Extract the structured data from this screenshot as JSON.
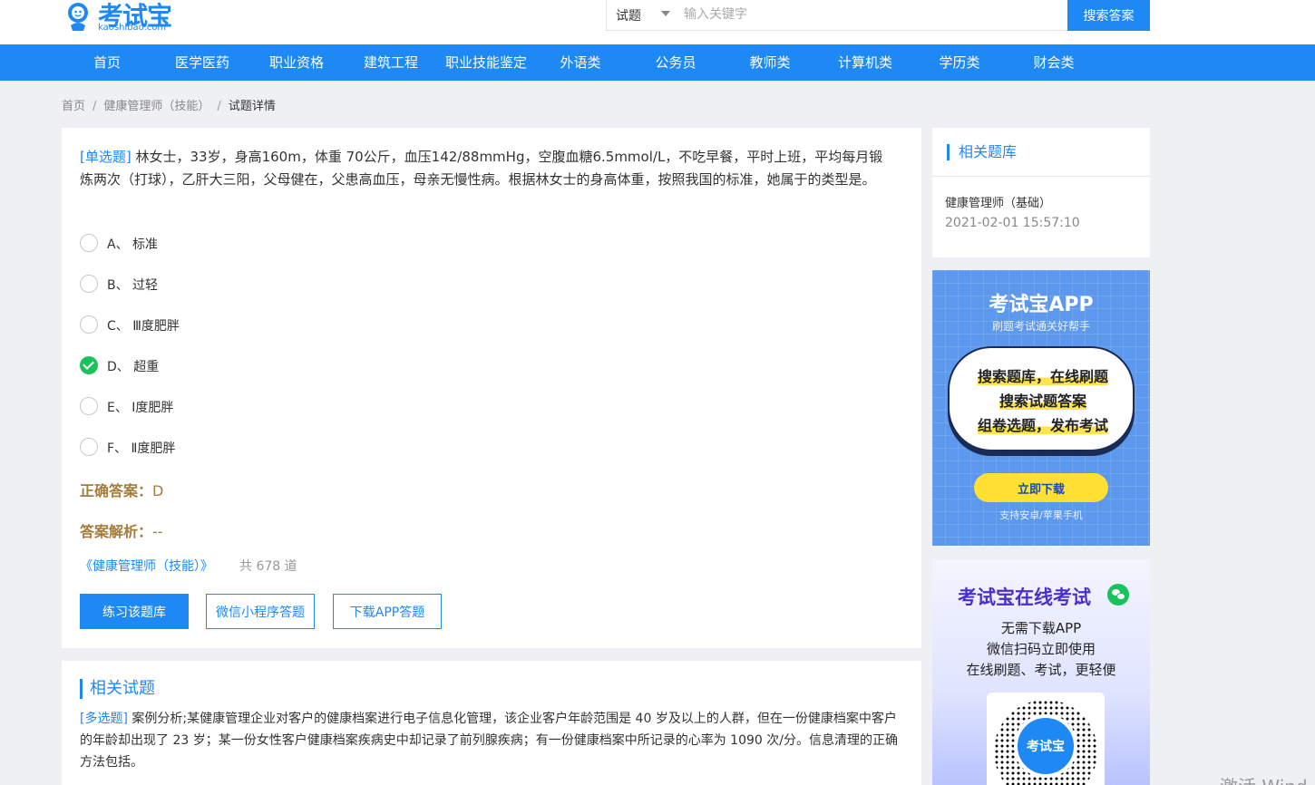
{
  "header": {
    "logo_text": "考试宝",
    "logo_url": "kaoshibao.com",
    "search": {
      "type_label": "试题",
      "placeholder": "输入关键字",
      "button_label": "搜索答案"
    }
  },
  "nav": [
    "首页",
    "医学医药",
    "职业资格",
    "建筑工程",
    "职业技能鉴定",
    "外语类",
    "公务员",
    "教师类",
    "计算机类",
    "学历类",
    "财会类"
  ],
  "breadcrumb": {
    "home": "首页",
    "category": "健康管理师（技能）",
    "current": "试题详情",
    "sep": "/"
  },
  "question": {
    "tag": "[单选题]",
    "text": " 林女士，33岁，身高160m，体重 70公斤，血压142/88mmHg，空腹血糖6.5mmol/L，不吃早餐，平时上班，平均每月锻炼两次（打球），乙肝大三阳，父母健在，父患高血压，母亲无慢性病。根据林女士的身高体重，按照我国的标准，她属于的类型是。",
    "options": [
      {
        "label": "A、 标准",
        "checked": false
      },
      {
        "label": "B、 过轻",
        "checked": false
      },
      {
        "label": "C、 Ⅲ度肥胖",
        "checked": false
      },
      {
        "label": "D、 超重",
        "checked": true
      },
      {
        "label": "E、 Ⅰ度肥胖",
        "checked": false
      },
      {
        "label": "F、 Ⅱ度肥胖",
        "checked": false
      }
    ],
    "answer_label": "正确答案：",
    "answer_value": "D",
    "analysis_label": "答案解析：",
    "analysis_value": "--",
    "bank_link": "《健康管理师（技能）》",
    "bank_count": "共 678 道",
    "buttons": {
      "practice": "练习该题库",
      "wechat": "微信小程序答题",
      "download": "下载APP答题"
    }
  },
  "related": {
    "title": "相关试题",
    "tag": "[多选题]",
    "text": " 案例分析;某健康管理企业对客户的健康档案进行电子信息化管理，该企业客户年龄范围是 40 岁及以上的人群，但在一份健康档案中客户的年龄却出现了 23 岁；某一份女性客户健康档案疾病史中却记录了前列腺疾病；有一份健康档案中所记录的心率为 1090 次/分。信息清理的正确方法包括。"
  },
  "sidebar": {
    "title": "相关题库",
    "bank_name": "健康管理师（基础）",
    "bank_date": "2021-02-01 15:57:10"
  },
  "ad_app": {
    "title": "考试宝APP",
    "subtitle": "刷题考试通关好帮手",
    "lines": [
      "搜索题库，在线刷题",
      "搜索试题答案",
      "组卷选题，发布考试"
    ],
    "button": "立即下载",
    "footer": "支持安卓/苹果手机"
  },
  "ad_online": {
    "title": "考试宝在线考试",
    "lines": [
      "无需下载APP",
      "微信扫码立即使用",
      "在线刷题、考试，更轻便"
    ],
    "qr_label": "考试宝"
  },
  "watermark": "激活 Wind",
  "colors": {
    "primary": "#1e88f5",
    "answer": "#a67c3c",
    "checked": "#19c35b"
  }
}
